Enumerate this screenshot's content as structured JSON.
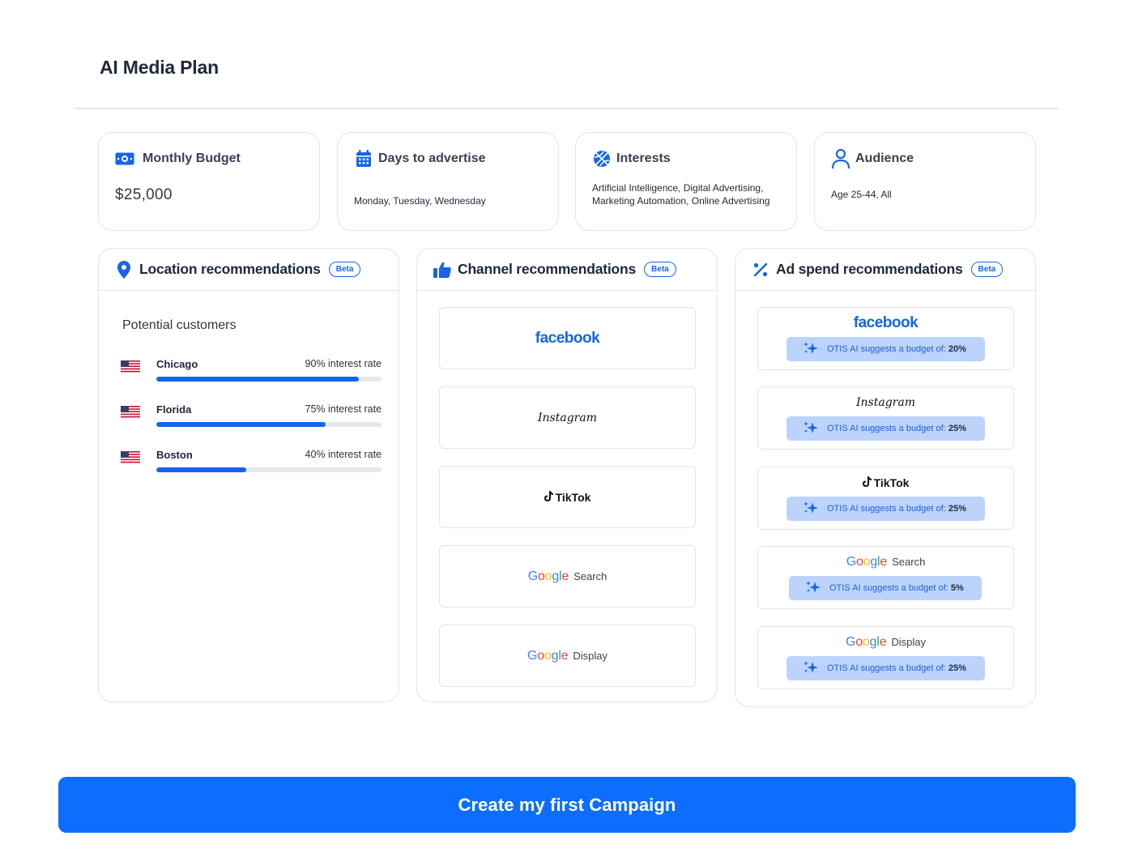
{
  "page": {
    "title": "AI Media Plan"
  },
  "summary": {
    "budget": {
      "label": "Monthly Budget",
      "value": "$25,000"
    },
    "days": {
      "label": "Days to advertise",
      "value": "Monday, Tuesday, Wednesday"
    },
    "interests": {
      "label": "Interests",
      "value": "Artificial Intelligence, Digital Advertising, Marketing Automation, Online Advertising"
    },
    "audience": {
      "label": "Audience",
      "value": "Age 25-44, All"
    }
  },
  "location": {
    "title": "Location recommendations",
    "beta": "Beta",
    "subtitle": "Potential customers",
    "items": [
      {
        "name": "Chicago",
        "rate_label": "90% interest rate",
        "rate": 0.9
      },
      {
        "name": "Florida",
        "rate_label": "75% interest rate",
        "rate": 0.75
      },
      {
        "name": "Boston",
        "rate_label": "40% interest rate",
        "rate": 0.4
      }
    ]
  },
  "channel": {
    "title": "Channel recommendations",
    "beta": "Beta",
    "items": [
      {
        "logo": "facebook"
      },
      {
        "logo": "Instagram"
      },
      {
        "logo": "TikTok"
      },
      {
        "logo": "Google",
        "sub": "Search"
      },
      {
        "logo": "Google",
        "sub": "Display"
      }
    ]
  },
  "adspend": {
    "title": "Ad spend recommendations",
    "beta": "Beta",
    "suggest_prefix": "OTIS AI suggests a budget of:",
    "items": [
      {
        "logo": "facebook",
        "percent": "20%"
      },
      {
        "logo": "Instagram",
        "percent": "25%"
      },
      {
        "logo": "TikTok",
        "percent": "25%"
      },
      {
        "logo": "Google",
        "sub": "Search",
        "percent": "5%"
      },
      {
        "logo": "Google",
        "sub": "Display",
        "percent": "25%"
      }
    ]
  },
  "colors": {
    "primary": "#0d6efd",
    "accent": "#1565e8",
    "suggest_bg": "#bcd4fb"
  },
  "cta": {
    "label": "Create my first Campaign"
  }
}
